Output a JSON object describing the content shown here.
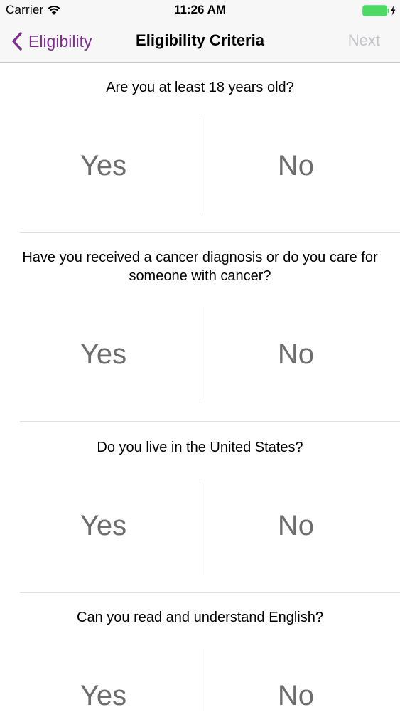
{
  "status_bar": {
    "carrier": "Carrier",
    "time": "11:26 AM",
    "wifi_icon": "wifi-icon",
    "battery_icon": "battery-charging-icon",
    "battery_color": "#4cd964"
  },
  "nav": {
    "back_label": "Eligibility",
    "title": "Eligibility Criteria",
    "next_label": "Next",
    "accent_color": "#7e2f8e",
    "next_disabled_color": "#c4c4c8"
  },
  "questions": [
    {
      "text": "Are you at least 18 years old?",
      "yes_label": "Yes",
      "no_label": "No"
    },
    {
      "text": "Have you received a cancer diagnosis or do you care for someone with cancer?",
      "yes_label": "Yes",
      "no_label": "No"
    },
    {
      "text": "Do you live in the United States?",
      "yes_label": "Yes",
      "no_label": "No"
    },
    {
      "text": "Can you read and understand English?",
      "yes_label": "Yes",
      "no_label": "No"
    }
  ]
}
